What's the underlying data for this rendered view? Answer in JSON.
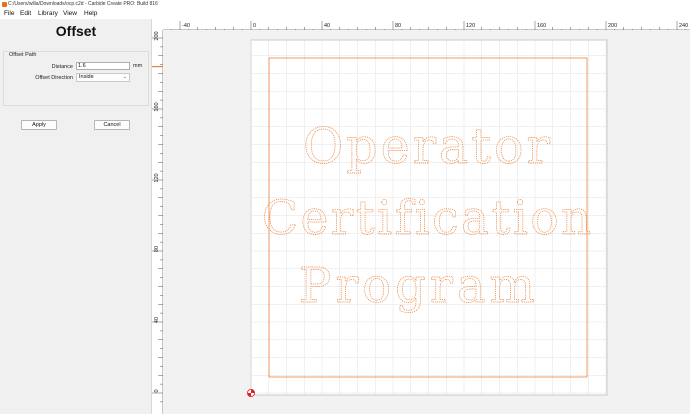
{
  "titlebar": {
    "title": "C:/Users/willa/Downloads/ocp.c2d - Carbide Create PRO: Build 816"
  },
  "menu": {
    "file": "File",
    "edit": "Edit",
    "library": "Library",
    "view": "View",
    "help": "Help"
  },
  "panel": {
    "title": "Offset",
    "group_title": "Offset Path",
    "distance_label": "Distance",
    "distance_value": "1.6",
    "distance_unit": "mm",
    "direction_label": "Offset Direction",
    "direction_value": "Inside",
    "apply_label": "Apply",
    "cancel_label": "Cancel"
  },
  "rulers": {
    "x_ticks": [
      "-40",
      "0",
      "40",
      "80",
      "120",
      "160",
      "200",
      "240"
    ],
    "y_ticks": [
      "200",
      "160",
      "120",
      "80",
      "40",
      "0"
    ]
  },
  "canvas": {
    "text_lines": [
      "Operator",
      "Certification",
      "Program"
    ],
    "accent_color": "#e8843c",
    "origin_marker_color": "#e02020"
  }
}
